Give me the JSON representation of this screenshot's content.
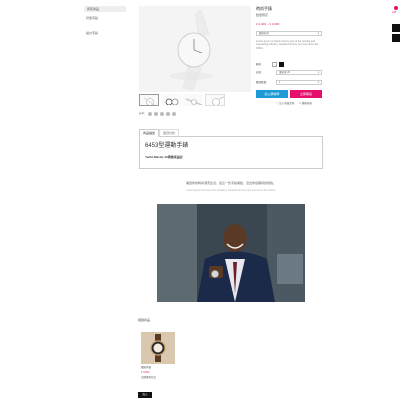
{
  "sidebar": {
    "header": "所有商品",
    "items": [
      "智能手錶",
      "設計手錶"
    ]
  },
  "right_rail": {
    "badge_text": "在線"
  },
  "product": {
    "title": "時尚手錶",
    "subtitle": "數量限定",
    "price": "¥ 2,400 – ¥ 3,600",
    "variant_select": "細與粉木",
    "description": "Lorem ipsum is simply dummy text of the printing and typesetting industry, standard dummy text ever since the 1500s.",
    "color_label": "顏色：",
    "colors": [
      "#ffffff",
      "#111111"
    ],
    "size_label": "表帶：",
    "size_select": "課表帶 20",
    "qty_label": "購買數量：",
    "qty_value": "1",
    "share_label": "分享：",
    "add_to_cart": "加入購物車",
    "buy_now": "立即購買",
    "wishlist": "加入收藏清單",
    "contact": "聯絡客服"
  },
  "tabs": [
    "商品描述",
    "送貨付款"
  ],
  "details": {
    "heading": "6453型運動手錶",
    "subheading": "Yacht-Master 40與魚灰設計",
    "cn_paragraph": "開啟你的時尚潮流生活，從這一隻手錶開始，活出你最獨特的風格。",
    "en_paragraph": "Lorem ipsum has been the industry's standard dummy text ever since the 1500s."
  },
  "related": {
    "title": "相關商品",
    "item_name": "潮流手錶",
    "item_price": "¥ 3,600",
    "item_note": "加購優惠商品",
    "add_button": "加入"
  },
  "accent_colors": {
    "primary_button": "#1e9bd7",
    "buy_button": "#e6106c",
    "price": "#d21a4f"
  }
}
